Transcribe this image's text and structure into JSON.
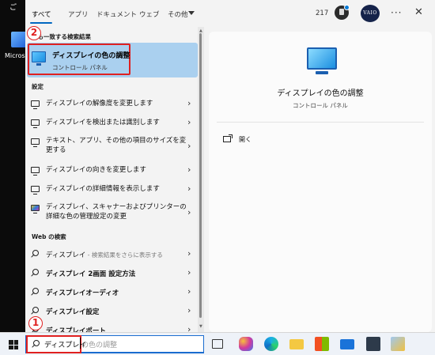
{
  "desktop": {
    "label": "Micros",
    "top_char": "ご"
  },
  "tabs": [
    {
      "label": "すべて"
    },
    {
      "label": "アプリ"
    },
    {
      "label": "ドキュメント"
    },
    {
      "label": "ウェブ"
    },
    {
      "label": "その他"
    }
  ],
  "header": {
    "points": "217",
    "avatar_text": "VAIO"
  },
  "best_match": {
    "section_label": "最も一致する検索結果",
    "title": "ディスプレイの色の調整",
    "subtitle": "コントロール パネル"
  },
  "settings": {
    "section_label": "設定",
    "items": [
      {
        "label": "ディスプレイの解像度を変更します"
      },
      {
        "label": "ディスプレイを検出または識別します"
      },
      {
        "label": "テキスト、アプリ、その他の項目のサイズを変更する"
      },
      {
        "label": "ディスプレイの向きを変更します"
      },
      {
        "label": "ディスプレイの詳細情報を表示します"
      },
      {
        "label": "ディスプレイ、スキャナーおよびプリンターの詳細な色の管理設定の変更"
      }
    ]
  },
  "web": {
    "section_label": "Web の検索",
    "items": [
      {
        "label": "ディスプレイ",
        "hint": " - 検索結果をさらに表示する"
      },
      {
        "label": "ディスプレイ 2画面 設定方法",
        "hint": ""
      },
      {
        "label": "ディスプレイオーディオ",
        "hint": ""
      },
      {
        "label": "ディスプレイ設定",
        "hint": ""
      },
      {
        "label": "ディスプレイポート",
        "hint": ""
      }
    ]
  },
  "preview": {
    "title": "ディスプレイの色の調整",
    "subtitle": "コントロール パネル",
    "open_label": "開く"
  },
  "annotations": {
    "step1": "1",
    "step2": "2"
  },
  "taskbar": {
    "search_typed": "ディスプレイ",
    "search_hint": "の色の調整"
  },
  "colors": {
    "accent": "#0067c0",
    "highlight_red": "#e02020",
    "selected_bg": "#aad0ef"
  }
}
